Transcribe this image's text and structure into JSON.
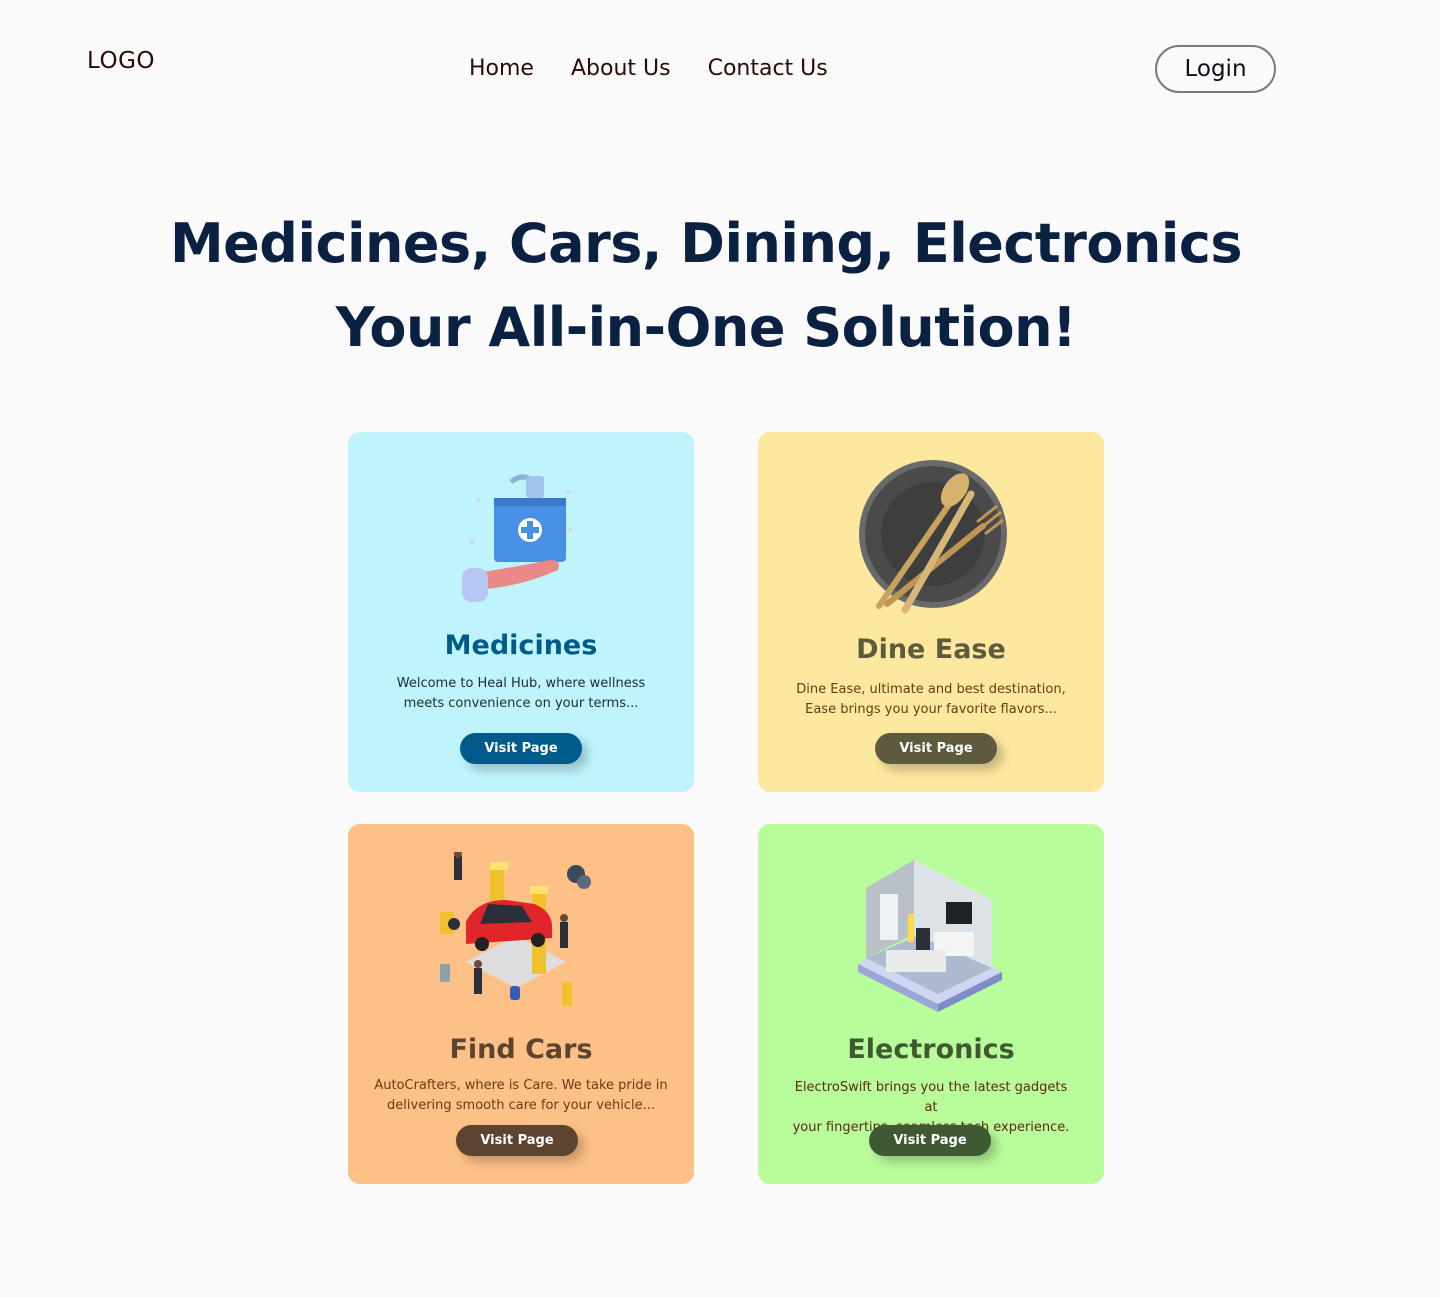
{
  "header": {
    "logo": "LOGO",
    "nav": [
      "Home",
      "About Us",
      "Contact Us"
    ],
    "login": "Login"
  },
  "hero": {
    "line1": "Medicines, Cars, Dining, Electronics",
    "line2": "Your All-in-One Solution!"
  },
  "cards": [
    {
      "title": "Medicines",
      "desc_line1": "Welcome to Heal Hub, where wellness",
      "desc_line2": "meets convenience on your terms...",
      "button": "Visit Page",
      "background": "#bff4fc",
      "accent": "#005a8a",
      "icon": "medical-bag-icon"
    },
    {
      "title": "Dine Ease",
      "desc_line1": "Dine Ease, ultimate and best destination,",
      "desc_line2": "Ease brings you your favorite flavors...",
      "button": "Visit Page",
      "background": "#fde8a0",
      "accent": "#5d5a3d",
      "icon": "plate-cutlery-icon"
    },
    {
      "title": "Find Cars",
      "desc_line1": "AutoCrafters, where is Care. We take pride in",
      "desc_line2": "delivering smooth care for your vehicle...",
      "button": "Visit Page",
      "background": "#fdc087",
      "accent": "#5d4431",
      "icon": "car-service-icon"
    },
    {
      "title": "Electronics",
      "desc_line1": "ElectroSwift brings you the latest gadgets at",
      "desc_line2": "your fingertips, seamless tech experience.",
      "button": "Visit Page",
      "background": "#b9fc9b",
      "accent": "#3f5a32",
      "icon": "smart-room-icon"
    }
  ]
}
